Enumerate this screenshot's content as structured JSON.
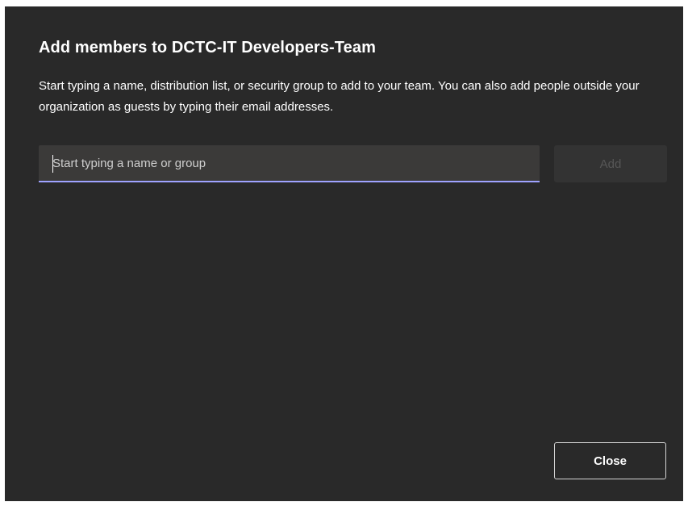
{
  "dialog": {
    "title": "Add members to DCTC-IT Developers-Team",
    "description": "Start typing a name, distribution list, or security group to add to your team. You can also add people outside your organization as guests by typing their email addresses.",
    "search": {
      "value": "",
      "placeholder": "Start typing a name or group"
    },
    "add_label": "Add",
    "close_label": "Close"
  },
  "colors": {
    "dialog_background": "#292929",
    "input_background": "#3b3a39",
    "input_underline_accent": "#9ea2ff",
    "disabled_button_background": "#333333",
    "disabled_button_text": "#575757"
  }
}
